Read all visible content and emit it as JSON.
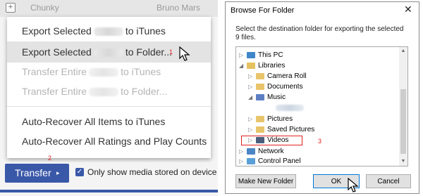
{
  "background_row": {
    "song": "Chunky",
    "artist": "Bruno Mars",
    "add_glyph": "+"
  },
  "context_menu": {
    "items": [
      {
        "before": "Export Selected",
        "after": "to iTunes",
        "state": "enabled"
      },
      {
        "before": "Export Selected",
        "after": "to Folder...",
        "state": "hover"
      },
      {
        "before": "Transfer Entire",
        "after": "to iTunes",
        "state": "disabled"
      },
      {
        "before": "Transfer Entire",
        "after": "to Folder...",
        "state": "disabled"
      },
      {
        "label": "Auto-Recover All Items to iTunes",
        "state": "enabled"
      },
      {
        "label": "Auto-Recover All Ratings and Play Counts",
        "state": "enabled"
      }
    ]
  },
  "annotations": {
    "step1": "1",
    "step2": "2",
    "step3": "3",
    "color": "#e0201e"
  },
  "bottom_bar": {
    "transfer_label": "Transfer",
    "transfer_caret": "▸",
    "only_show_label": "Only show media stored on device",
    "only_show_checked": true,
    "accent_color": "#3a58a8"
  },
  "dialog": {
    "title": "Browse For Folder",
    "close_glyph": "✕",
    "message": "Select the destination folder for exporting the selected 9 files.",
    "tree": [
      {
        "label": "This PC",
        "expanded": false,
        "icon": "computer-icon"
      },
      {
        "label": "Libraries",
        "expanded": true,
        "icon": "libraries-icon"
      },
      {
        "label": "Camera Roll",
        "expanded": false,
        "icon": "folder-icon"
      },
      {
        "label": "Documents",
        "expanded": false,
        "icon": "folder-icon"
      },
      {
        "label": "Music",
        "expanded": true,
        "icon": "music-icon"
      },
      {
        "label": "",
        "expanded": null,
        "icon": "blurred-item"
      },
      {
        "label": "Pictures",
        "expanded": false,
        "icon": "folder-icon"
      },
      {
        "label": "Saved Pictures",
        "expanded": false,
        "icon": "folder-icon"
      },
      {
        "label": "Videos",
        "expanded": false,
        "icon": "video-icon",
        "selected": true
      },
      {
        "label": "Network",
        "expanded": false,
        "icon": "network-icon"
      },
      {
        "label": "Control Panel",
        "expanded": false,
        "icon": "control-panel-icon"
      }
    ],
    "buttons": {
      "new_folder": "Make New Folder",
      "ok": "OK",
      "cancel": "Cancel"
    }
  }
}
